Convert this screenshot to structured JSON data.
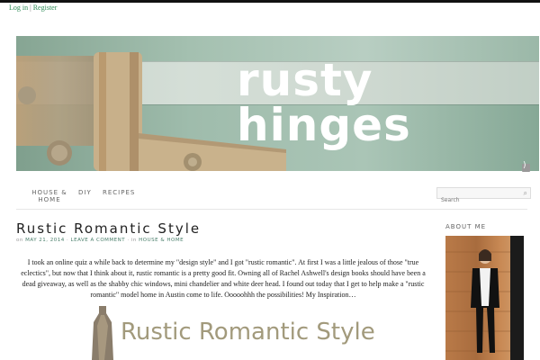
{
  "userlinks": {
    "login": "Log in",
    "separator": "|",
    "register": "Register"
  },
  "banner": {
    "title": "rusty hinges"
  },
  "nav": {
    "items": [
      {
        "label": "House &",
        "label2": "Home"
      },
      {
        "label": "DIY"
      },
      {
        "label": "Recipes"
      }
    ]
  },
  "search": {
    "placeholder": "Search"
  },
  "post": {
    "title": "Rustic Romantic Style",
    "meta_on": "on",
    "date": "May 21, 2014",
    "dot": "·",
    "comment_link": "Leave a Comment",
    "meta_in": "in",
    "category": "House & Home",
    "body": "I took an online quiz a while back to determine my \"design style\" and I got \"rustic romantic\". At first I was a little jealous of those \"true eclectics\", but now that I think about it, rustic romantic is a pretty good fit. Owning all of Rachel Ashwell's design books should have been a dead giveaway, as well as the shabby chic windows, mini chandelier and white deer head. I found out today that I get to help make a \"rustic romantic\" model home in Austin come to life. Ooooohhh the possibilities! My Inspiration…",
    "image_text": "Rustic Romantic Style"
  },
  "sidebar": {
    "about_title": "About Me"
  },
  "colors": {
    "link": "#2e8b57",
    "topbar": "#111111",
    "banner_teal": "#9db9aa"
  }
}
